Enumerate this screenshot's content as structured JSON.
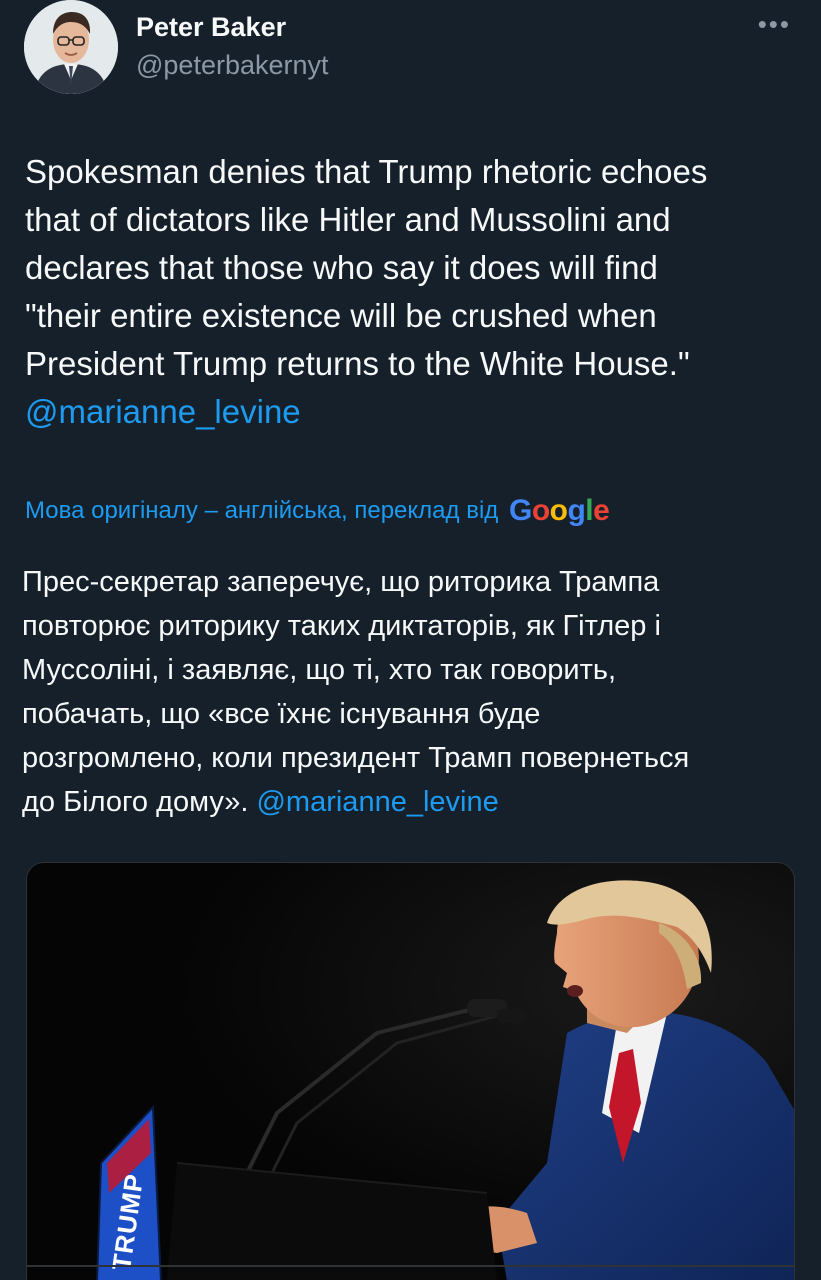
{
  "author": {
    "display_name": "Peter Baker",
    "handle": "@peterbakernyt"
  },
  "tweet": {
    "text_lines": [
      "Spokesman denies that Trump rhetoric echoes",
      "that of dictators like Hitler and Mussolini and",
      "declares that those who say it does will find",
      "\"their entire existence will be crushed when",
      "President Trump returns to the White House.\""
    ],
    "mention": "@marianne_levine"
  },
  "translation": {
    "note": "Мова оригіналу – англійська, переклад від",
    "provider_logo": "Google",
    "text_lines": [
      "Прес-секретар заперечує, що риторика Трампа",
      "повторює риторику таких диктаторів, як Гітлер і",
      "Муссоліні, і заявляє, що ті, хто так говорить,",
      "побачать, що «все їхнє існування буде",
      "розгромлено, коли президент Трамп повернеться",
      "до Білого дому»."
    ],
    "mention": "@marianne_levine"
  },
  "media": {
    "sign_text": "TRUMP"
  },
  "icons": {
    "more": "more-options-icon",
    "avatar": "avatar-photo"
  },
  "colors": {
    "background": "#15202b",
    "text": "#f7f9f9",
    "secondary": "#8b98a5",
    "link": "#1d9bf0"
  }
}
